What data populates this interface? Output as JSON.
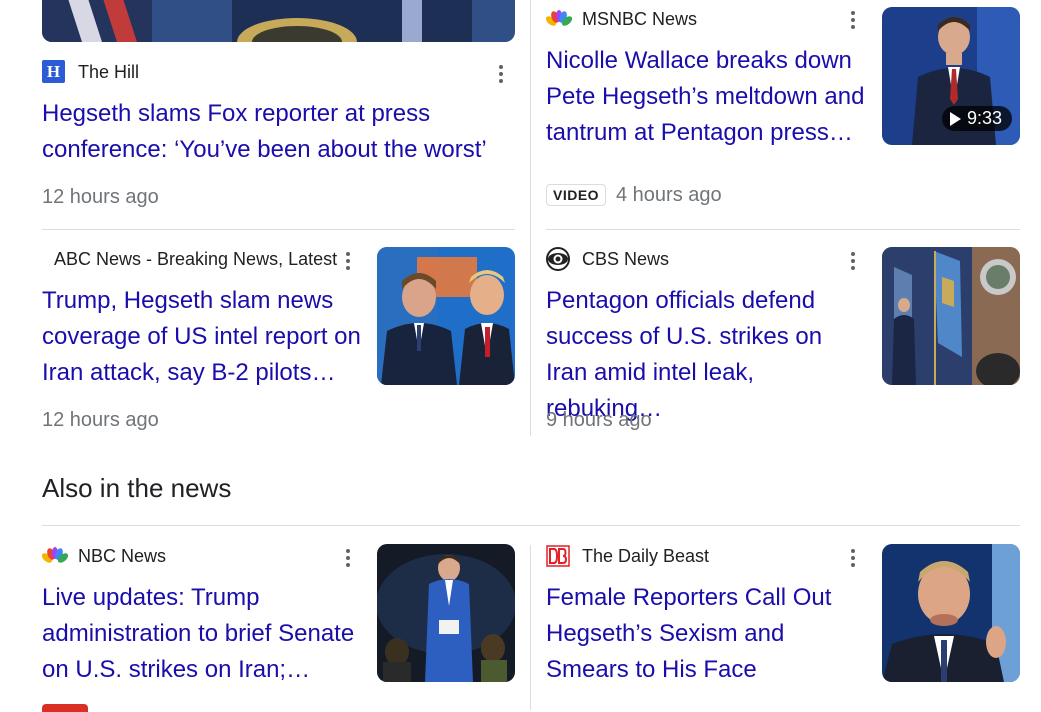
{
  "top_left": {
    "source": "The Hill",
    "title_line1": "Hegseth slams Fox reporter at press",
    "title_line2": "conference: ‘You’ve been about the worst’",
    "time": "12 hours ago"
  },
  "top_right": {
    "source": "MSNBC News",
    "title_line1": "Nicolle Wallace breaks down",
    "title_line2": "Pete Hegseth’s meltdown and",
    "title_line3": "tantrum at Pentagon press…",
    "badge": "VIDEO",
    "time": "4 hours ago",
    "duration": "9:33"
  },
  "mid_left": {
    "source": "ABC News - Breaking News, Latest",
    "title_line1": "Trump, Hegseth slam news",
    "title_line2": "coverage of US intel report on",
    "title_line3": "Iran attack, say B-2 pilots…",
    "time": "12 hours ago"
  },
  "mid_right": {
    "source": "CBS News",
    "title_line1": "Pentagon officials defend",
    "title_line2": "success of U.S. strikes on",
    "title_line3": "Iran amid intel leak, rebuking…",
    "time": "9 hours ago"
  },
  "section": {
    "heading": "Also in the news"
  },
  "bottom_left": {
    "source": "NBC News",
    "title_line1": "Live updates: Trump",
    "title_line2": "administration to brief Senate",
    "title_line3": "on U.S. strikes on Iran;…"
  },
  "bottom_right": {
    "source": "The Daily Beast",
    "title_line1": "Female Reporters Call Out",
    "title_line2": "Hegseth’s Sexism and",
    "title_line3": "Smears to His Face"
  },
  "colors": {
    "link": "#1a0dab",
    "meta": "#70757a",
    "divider": "#dadce0",
    "hill_blue": "#2b5cd6",
    "daily_beast_red": "#e32128"
  }
}
